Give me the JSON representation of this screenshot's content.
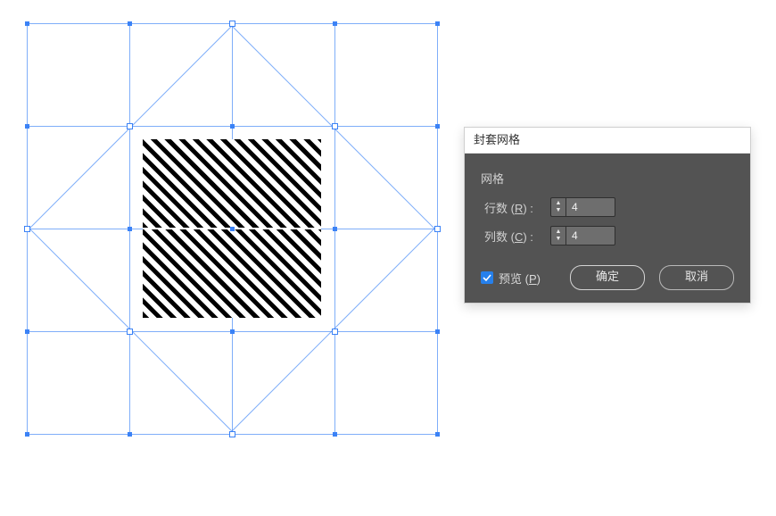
{
  "dialog": {
    "title": "封套网格",
    "group_label": "网格",
    "rows_label_prefix": "行数 (",
    "rows_mnemonic": "R",
    "rows_label_suffix": ") :",
    "rows_value": "4",
    "cols_label_prefix": "列数 (",
    "cols_mnemonic": "C",
    "cols_label_suffix": ") :",
    "cols_value": "4",
    "preview_label_prefix": "预览 (",
    "preview_mnemonic": "P",
    "preview_label_suffix": ")",
    "preview_checked": true,
    "ok_label": "确定",
    "cancel_label": "取消"
  }
}
